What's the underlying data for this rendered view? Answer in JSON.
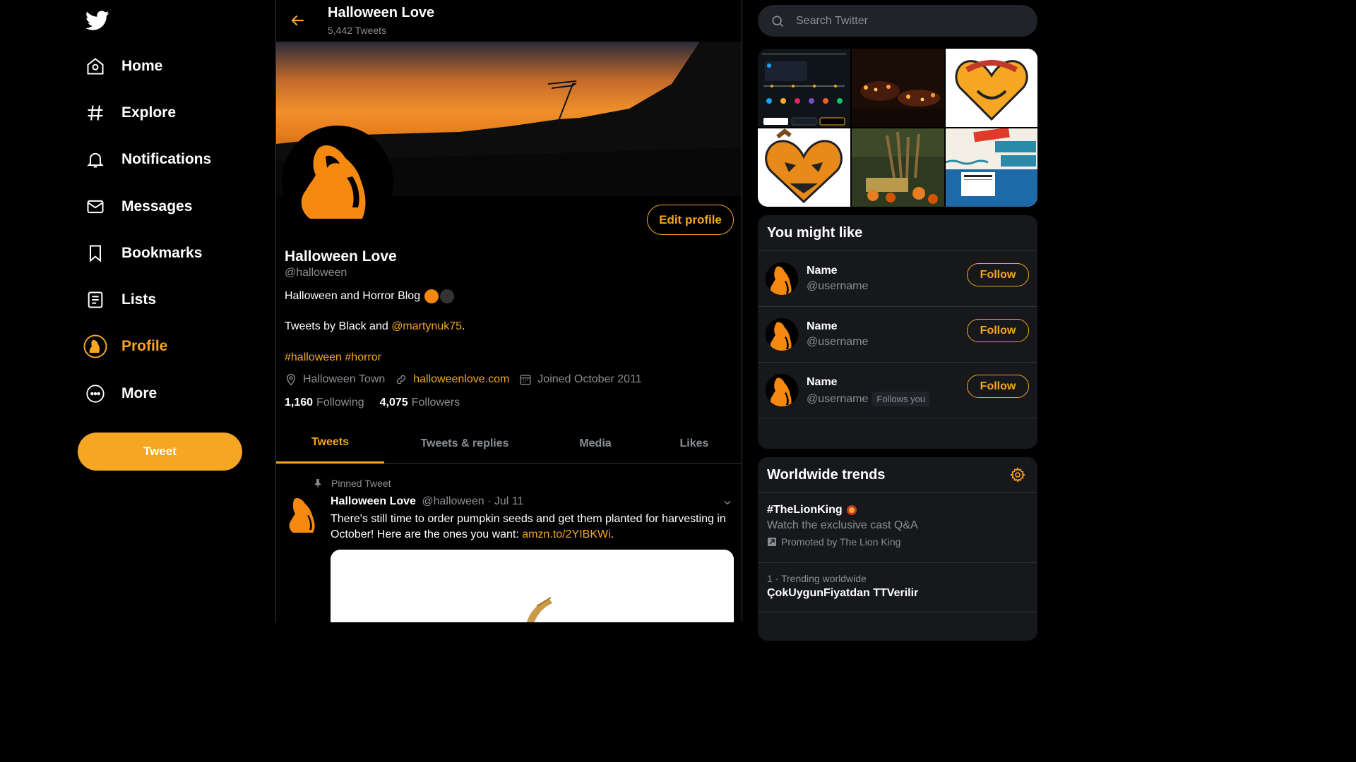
{
  "colors": {
    "accent": "#f5a623",
    "background": "#000000",
    "panel": "#16181c",
    "muted": "#8b8f93"
  },
  "nav": {
    "logo_icon": "twitter-bird-icon",
    "items": [
      {
        "label": "Home",
        "icon": "home-icon"
      },
      {
        "label": "Explore",
        "icon": "hashtag-icon"
      },
      {
        "label": "Notifications",
        "icon": "bell-icon"
      },
      {
        "label": "Messages",
        "icon": "envelope-icon"
      },
      {
        "label": "Bookmarks",
        "icon": "bookmark-icon"
      },
      {
        "label": "Lists",
        "icon": "list-icon"
      },
      {
        "label": "Profile",
        "icon": "profile-avatar-icon",
        "active": true
      },
      {
        "label": "More",
        "icon": "more-icon"
      }
    ],
    "tweet_button": "Tweet"
  },
  "header": {
    "title": "Halloween Love",
    "subtitle": "5,442 Tweets"
  },
  "profile": {
    "edit_button": "Edit profile",
    "name": "Halloween Love",
    "handle": "@halloween",
    "bio": "Halloween and Horror Blog",
    "by_prefix": "Tweets by Black and ",
    "by_link": "@martynuk75",
    "by_suffix": ".",
    "tags": "#halloween #horror",
    "location": "Halloween Town",
    "website": "halloweenlove.com",
    "joined": "Joined October 2011",
    "following_count": "1,160",
    "following_label": "Following",
    "followers_count": "4,075",
    "followers_label": "Followers"
  },
  "tabs": [
    "Tweets",
    "Tweets & replies",
    "Media",
    "Likes"
  ],
  "pinned_tweet": {
    "pinned_label": "Pinned Tweet",
    "author": "Halloween Love",
    "handle": "@halloween",
    "date": "· Jul 11",
    "text": "There's still time to order pumpkin seeds and get them planted for harvesting in October! Here are the ones you want: ",
    "link": "amzn.to/2YIBKWi",
    "text_suffix": "."
  },
  "search": {
    "placeholder": "Search Twitter"
  },
  "you_might_like": {
    "title": "You might like",
    "users": [
      {
        "name": "Name",
        "username": "@username",
        "button": "Follow",
        "follows_you": ""
      },
      {
        "name": "Name",
        "username": "@username",
        "button": "Follow",
        "follows_you": ""
      },
      {
        "name": "Name",
        "username": "@username",
        "button": "Follow",
        "follows_you": "Follows you"
      }
    ]
  },
  "trends": {
    "title": "Worldwide trends",
    "items": [
      {
        "tag": "#TheLionKing",
        "description": "Watch the exclusive cast Q&A",
        "promoted": "Promoted by The Lion King"
      },
      {
        "context": "1 · Trending worldwide",
        "tag": "ÇokUygunFiyatdan TTVerilir"
      }
    ]
  }
}
